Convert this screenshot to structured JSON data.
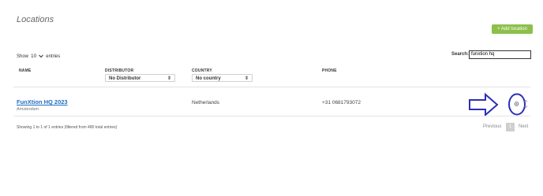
{
  "page": {
    "title": "Locations",
    "add_button": "+ Add location"
  },
  "controls": {
    "show_label": "Show",
    "entries_value": "10",
    "entries_label": "entries",
    "search_label": "Search:",
    "search_value": "funxtion hq"
  },
  "table": {
    "headers": [
      "NAME",
      "DISTRIBUTOR",
      "COUNTRY",
      "PHONE"
    ],
    "distributor_filter": "No Distributor",
    "country_filter": "No country",
    "rows": [
      {
        "name": "FunXtion HQ 2023",
        "city": "Amsterdam",
        "country": "Netherlands",
        "phone": "+31 0681793072"
      }
    ]
  },
  "footer": {
    "info": "Showing 1 to 1 of 1 entries (filtered from 480 total entries)",
    "previous": "Previous",
    "page": "1",
    "next": "Next"
  },
  "colors": {
    "accent": "#8cc04a",
    "link": "#1f6fbf",
    "annotation": "#2d2fb5"
  }
}
